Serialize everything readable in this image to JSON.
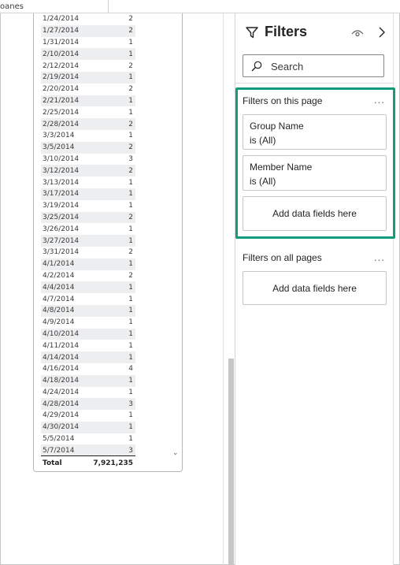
{
  "top_bar": {
    "label": "oanes"
  },
  "table": {
    "rows": [
      [
        "1/24/2014",
        "2"
      ],
      [
        "1/27/2014",
        "2"
      ],
      [
        "1/31/2014",
        "1"
      ],
      [
        "2/10/2014",
        "1"
      ],
      [
        "2/12/2014",
        "2"
      ],
      [
        "2/19/2014",
        "1"
      ],
      [
        "2/20/2014",
        "2"
      ],
      [
        "2/21/2014",
        "1"
      ],
      [
        "2/25/2014",
        "1"
      ],
      [
        "2/28/2014",
        "2"
      ],
      [
        "3/3/2014",
        "1"
      ],
      [
        "3/5/2014",
        "2"
      ],
      [
        "3/10/2014",
        "3"
      ],
      [
        "3/12/2014",
        "2"
      ],
      [
        "3/13/2014",
        "1"
      ],
      [
        "3/17/2014",
        "1"
      ],
      [
        "3/19/2014",
        "1"
      ],
      [
        "3/25/2014",
        "2"
      ],
      [
        "3/26/2014",
        "1"
      ],
      [
        "3/27/2014",
        "1"
      ],
      [
        "3/31/2014",
        "2"
      ],
      [
        "4/1/2014",
        "1"
      ],
      [
        "4/2/2014",
        "2"
      ],
      [
        "4/4/2014",
        "1"
      ],
      [
        "4/7/2014",
        "1"
      ],
      [
        "4/8/2014",
        "1"
      ],
      [
        "4/9/2014",
        "1"
      ],
      [
        "4/10/2014",
        "1"
      ],
      [
        "4/11/2014",
        "1"
      ],
      [
        "4/14/2014",
        "1"
      ],
      [
        "4/16/2014",
        "4"
      ],
      [
        "4/18/2014",
        "1"
      ],
      [
        "4/24/2014",
        "1"
      ],
      [
        "4/28/2014",
        "3"
      ],
      [
        "4/29/2014",
        "1"
      ],
      [
        "4/30/2014",
        "1"
      ],
      [
        "5/5/2014",
        "1"
      ],
      [
        "5/7/2014",
        "3"
      ]
    ],
    "total_label": "Total",
    "total_value": "7,921,235"
  },
  "filters_pane": {
    "title": "Filters",
    "search_label": "Search",
    "this_page": {
      "title": "Filters on this page",
      "more": "...",
      "cards": [
        {
          "name": "Group Name",
          "state": "is (All)"
        },
        {
          "name": "Member Name",
          "state": "is (All)"
        }
      ],
      "add_label": "Add data fields here"
    },
    "all_pages": {
      "title": "Filters on all pages",
      "more": "...",
      "add_label": "Add data fields here"
    }
  },
  "colors": {
    "highlight": "#139b7e",
    "row_alt": "#edeef0",
    "border": "#c8c6c4"
  },
  "icons": {
    "title": "filter-funnel-icon",
    "visibility": "eye-icon",
    "collapse": "chevron-right-icon",
    "search": "search-icon",
    "scroll_down": "chevron-down-icon"
  }
}
